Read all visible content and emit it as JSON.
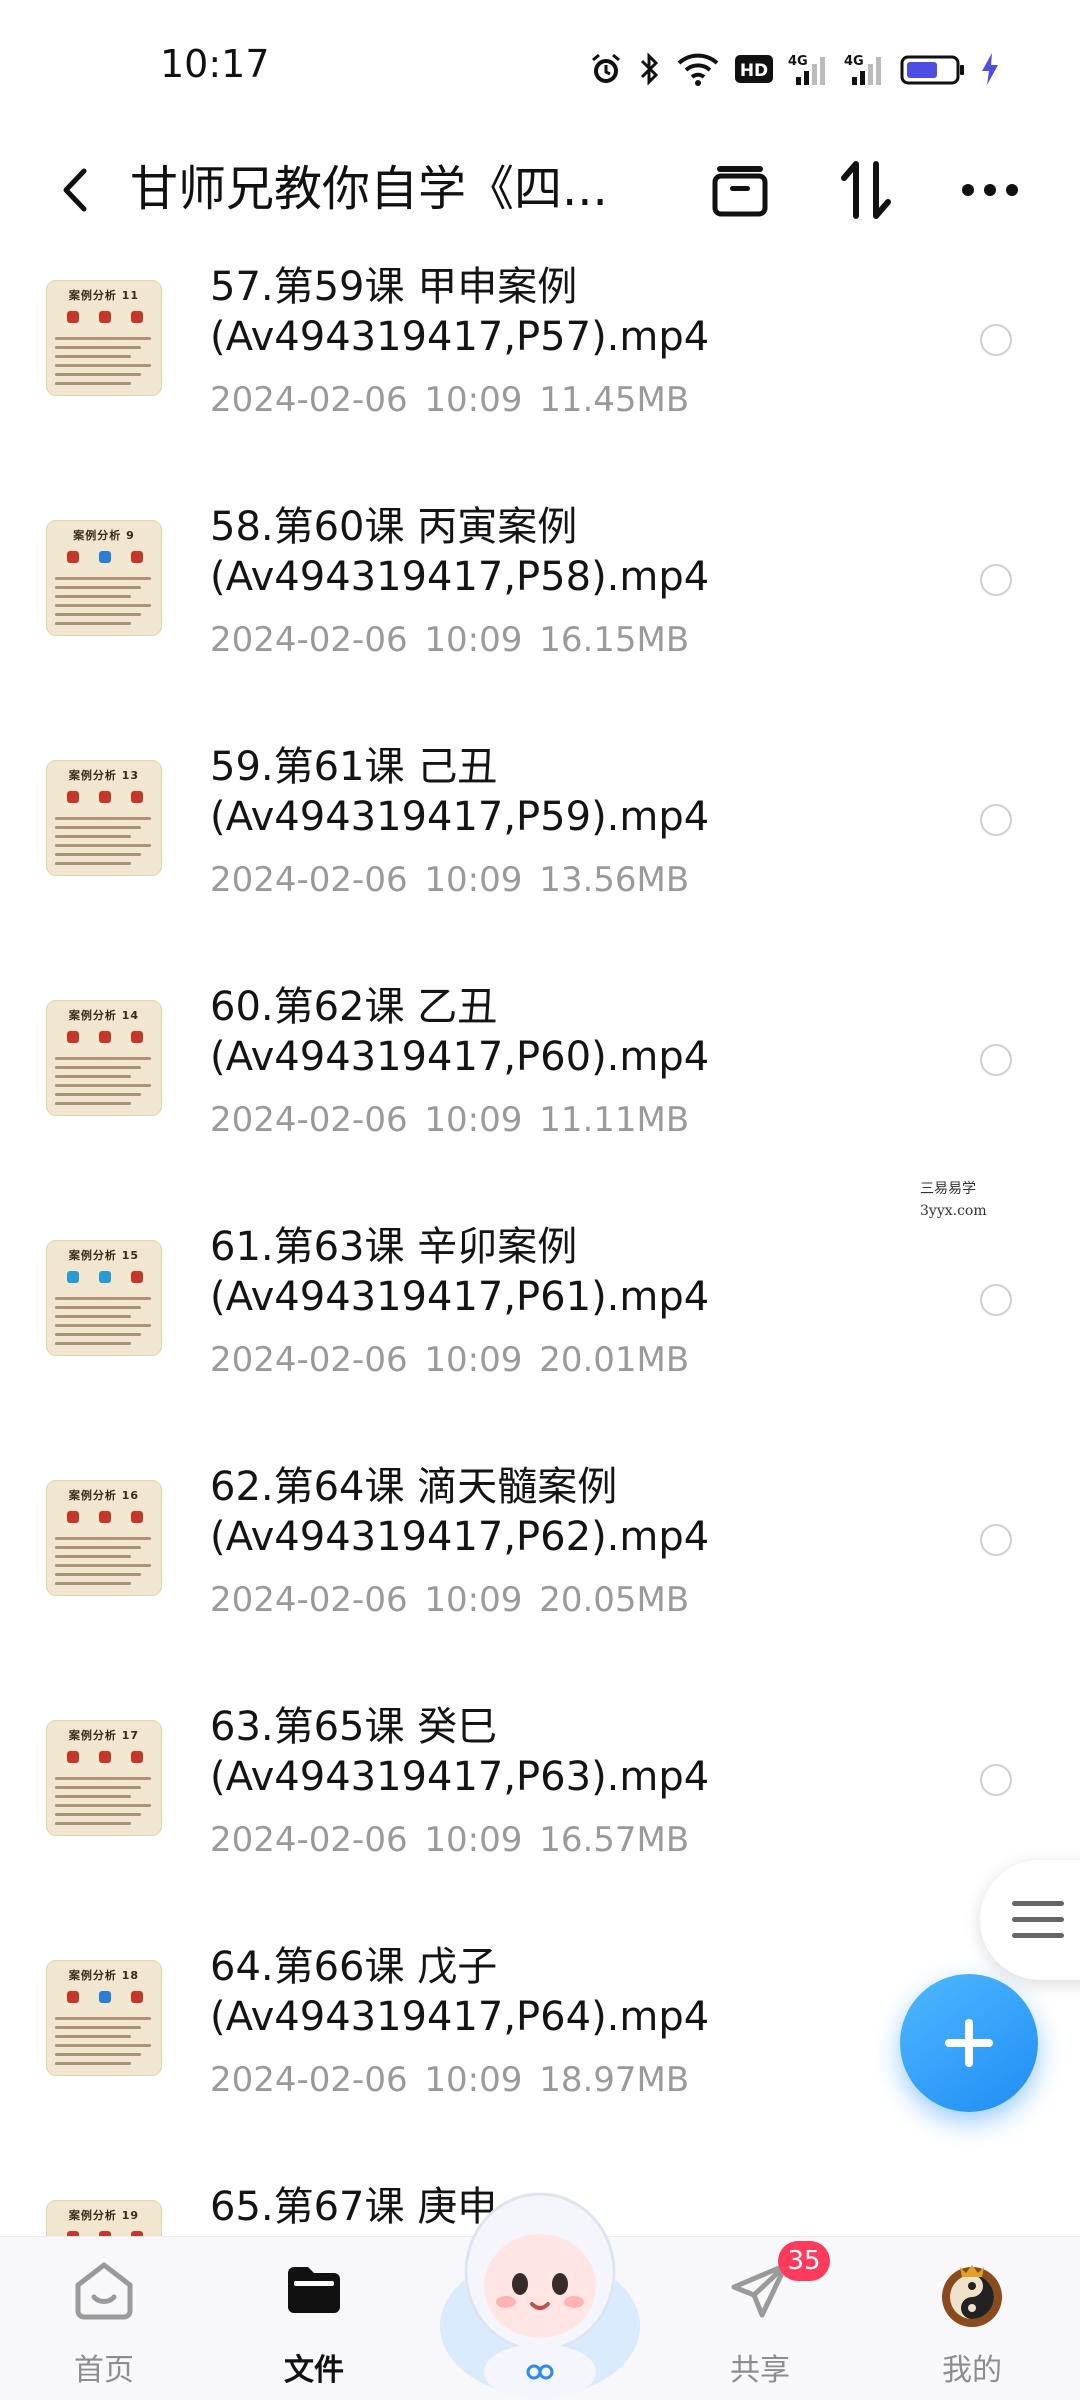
{
  "status_bar": {
    "time": "10:17",
    "icons": [
      "alarm-icon",
      "bluetooth-icon",
      "wifi-icon",
      "hd-icon",
      "signal-4g-icon",
      "signal-4g-icon",
      "battery-icon",
      "charging-icon"
    ],
    "hd_label": "HD",
    "net_label_1": "4G",
    "net_label_2": "4G"
  },
  "header": {
    "title": "甘师兄教你自学《四...",
    "icons": [
      "back-icon",
      "tray-icon",
      "sort-icon",
      "more-icon"
    ]
  },
  "files": [
    {
      "thumb_title": "案例分析 11",
      "name_line1": "57.第59课 甲申案例",
      "name_line2": "(Av494319417,P57).mp4",
      "date": "2024-02-06",
      "time": "10:09",
      "size": "11.45MB"
    },
    {
      "thumb_title": "案例分析 9",
      "name_line1": "58.第60课 丙寅案例",
      "name_line2": "(Av494319417,P58).mp4",
      "date": "2024-02-06",
      "time": "10:09",
      "size": "16.15MB"
    },
    {
      "thumb_title": "案例分析 13",
      "name_line1": "59.第61课 己丑",
      "name_line2": "(Av494319417,P59).mp4",
      "date": "2024-02-06",
      "time": "10:09",
      "size": "13.56MB"
    },
    {
      "thumb_title": "案例分析 14",
      "name_line1": "60.第62课 乙丑",
      "name_line2": "(Av494319417,P60).mp4",
      "date": "2024-02-06",
      "time": "10:09",
      "size": "11.11MB"
    },
    {
      "thumb_title": "案例分析 15",
      "name_line1": "61.第63课 辛卯案例",
      "name_line2": "(Av494319417,P61).mp4",
      "date": "2024-02-06",
      "time": "10:09",
      "size": "20.01MB"
    },
    {
      "thumb_title": "案例分析 16",
      "name_line1": "62.第64课 滴天髓案例",
      "name_line2": "(Av494319417,P62).mp4",
      "date": "2024-02-06",
      "time": "10:09",
      "size": "20.05MB"
    },
    {
      "thumb_title": "案例分析 17",
      "name_line1": "63.第65课 癸巳",
      "name_line2": "(Av494319417,P63).mp4",
      "date": "2024-02-06",
      "time": "10:09",
      "size": "16.57MB"
    },
    {
      "thumb_title": "案例分析 18",
      "name_line1": "64.第66课 戊子",
      "name_line2": "(Av494319417,P64).mp4",
      "date": "2024-02-06",
      "time": "10:09",
      "size": "18.97MB"
    },
    {
      "thumb_title": "案例分析 19",
      "name_line1": "65.第67课 庚申",
      "name_line2": "",
      "date": "",
      "time": "",
      "size": ""
    }
  ],
  "watermark": {
    "line1": "三易易学",
    "line2": "3yyx.com"
  },
  "colors": {
    "accent": "#1f8df5",
    "badge": "#ff3b5c",
    "meta_text": "#9a9a9a"
  },
  "bottom_nav": {
    "items": [
      {
        "label": "首页",
        "icon": "home-icon",
        "active": false
      },
      {
        "label": "文件",
        "icon": "folder-icon",
        "active": true
      },
      {
        "label": "共享",
        "icon": "send-icon",
        "active": false,
        "badge": "35"
      },
      {
        "label": "我的",
        "icon": "avatar-icon",
        "active": false
      }
    ]
  }
}
